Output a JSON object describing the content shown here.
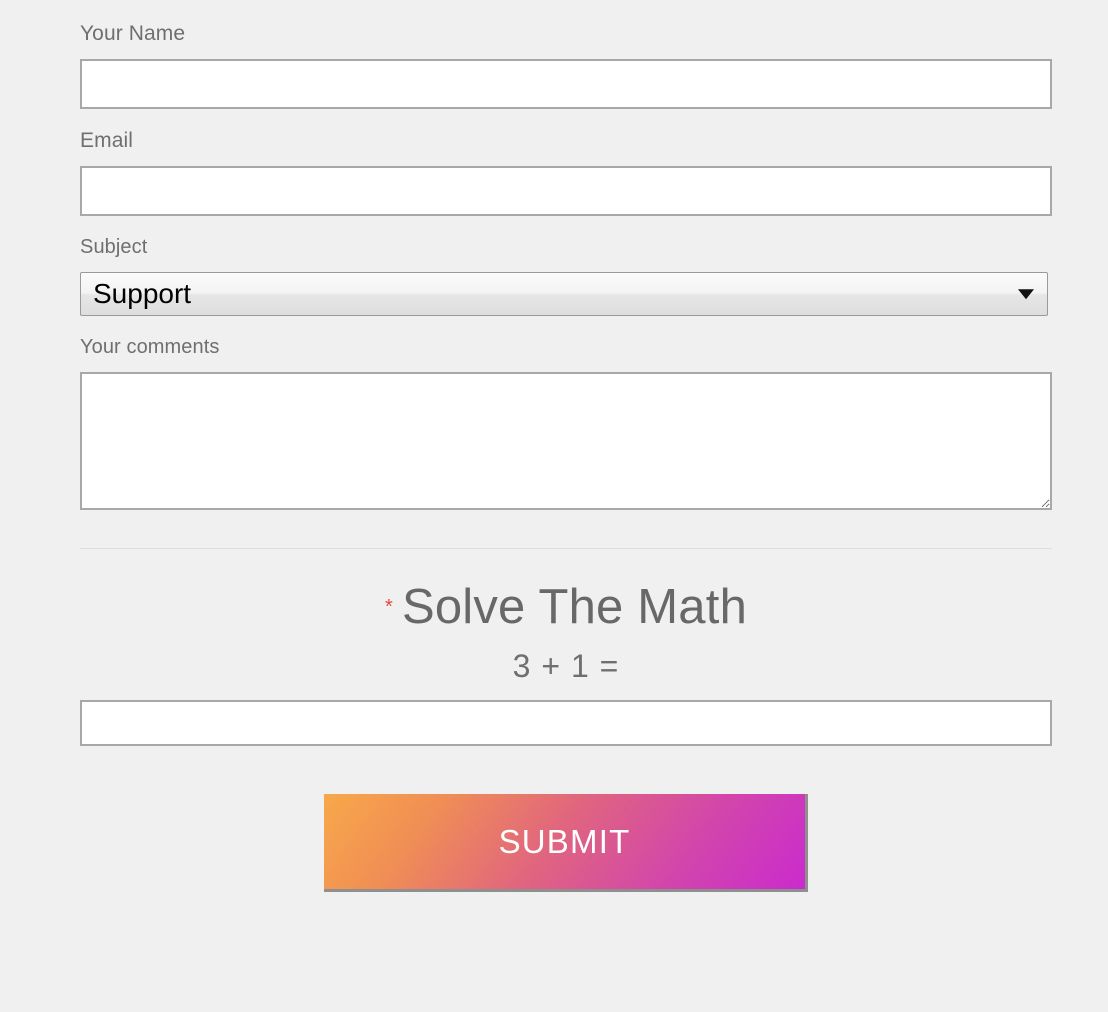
{
  "form": {
    "fields": {
      "name": {
        "label": "Your Name",
        "value": "",
        "placeholder": ""
      },
      "email": {
        "label": "Email",
        "value": "",
        "placeholder": ""
      },
      "subject": {
        "label": "Subject",
        "selected": "Support",
        "options": [
          "Support"
        ]
      },
      "comments": {
        "label": "Your comments",
        "value": "",
        "placeholder": ""
      }
    },
    "captcha": {
      "required_marker": "*",
      "heading": "Solve The Math",
      "question": "3 + 1 =",
      "answer_value": "",
      "answer_placeholder": ""
    },
    "submit": {
      "label": "SUBMIT"
    }
  },
  "icons": {
    "dropdown_arrow": "chevron-down-icon"
  },
  "colors": {
    "page_background": "#f0f0f0",
    "label_text": "#6f6f6f",
    "heading_text": "#686868",
    "input_border": "#a8a8a8",
    "input_background": "#ffffff",
    "divider": "#dcdcdc",
    "required_star": "#e8453c",
    "submit_gradient_start": "#f7a84a",
    "submit_gradient_end": "#ca2bcd",
    "submit_text": "#ffffff",
    "submit_shadow": "#8f8f8f"
  }
}
